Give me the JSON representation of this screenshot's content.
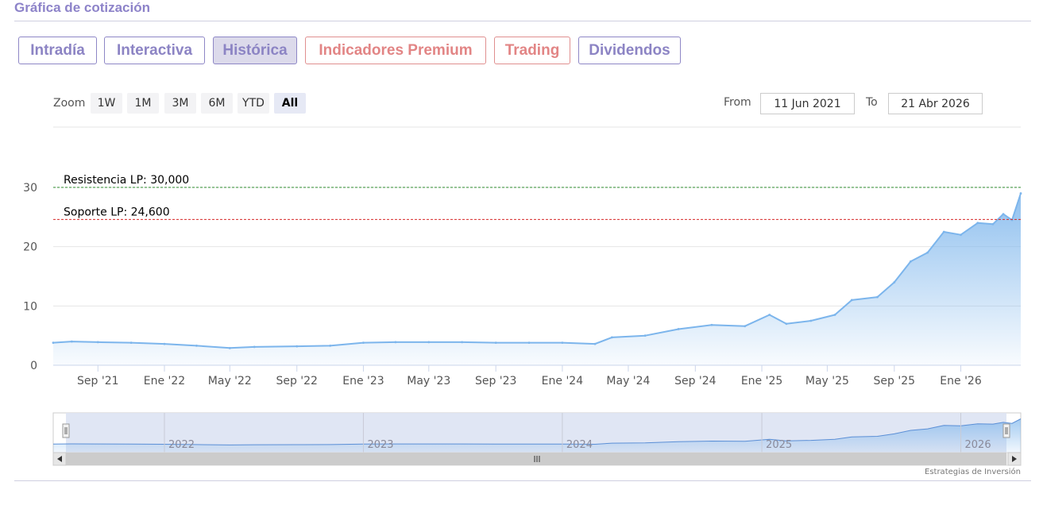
{
  "header": {
    "title": "Gráfica de cotización"
  },
  "tabs": [
    {
      "label": "Intradía",
      "active": false,
      "premium": false
    },
    {
      "label": "Interactiva",
      "active": false,
      "premium": false
    },
    {
      "label": "Histórica",
      "active": true,
      "premium": false
    },
    {
      "label": "Indicadores Premium",
      "active": false,
      "premium": true
    },
    {
      "label": "Trading",
      "active": false,
      "premium": true
    },
    {
      "label": "Dividendos",
      "active": false,
      "premium": false
    }
  ],
  "zoom": {
    "label": "Zoom",
    "buttons": [
      "1W",
      "1M",
      "3M",
      "6M",
      "YTD",
      "All"
    ],
    "selected": "All"
  },
  "range": {
    "from_label": "From",
    "from_value": "11 Jun 2021",
    "to_label": "To",
    "to_value": "21 Abr 2026"
  },
  "credits": "Estrategias de Inversión",
  "colors": {
    "accent": "#8c84c4",
    "premium": "#e28585",
    "series": "#7cb5ec",
    "resistance": "#2e8b2e",
    "support": "#d62828"
  },
  "chart_data": {
    "type": "area",
    "title": "",
    "xlabel": "",
    "ylabel": "",
    "ylim": [
      0,
      30
    ],
    "y_ticks": [
      "0",
      "10",
      "20",
      "30"
    ],
    "x_ticks": [
      "Sep '21",
      "Ene '22",
      "May '22",
      "Sep '22",
      "Ene '23",
      "May '23",
      "Sep '23",
      "Ene '24",
      "May '24",
      "Sep '24",
      "Ene '25",
      "May '25",
      "Sep '25",
      "Ene '26"
    ],
    "x_range": [
      "2021-06-11",
      "2026-04-21"
    ],
    "grid": "horizontal",
    "series": [
      {
        "points": [
          [
            "2021-06-11",
            3.8
          ],
          [
            "2021-07-15",
            4.0
          ],
          [
            "2021-09-01",
            3.9
          ],
          [
            "2021-11-01",
            3.8
          ],
          [
            "2022-01-01",
            3.6
          ],
          [
            "2022-03-01",
            3.3
          ],
          [
            "2022-05-01",
            2.9
          ],
          [
            "2022-06-15",
            3.1
          ],
          [
            "2022-09-01",
            3.2
          ],
          [
            "2022-11-01",
            3.3
          ],
          [
            "2023-01-01",
            3.8
          ],
          [
            "2023-03-01",
            3.9
          ],
          [
            "2023-05-01",
            3.9
          ],
          [
            "2023-07-01",
            3.9
          ],
          [
            "2023-09-01",
            3.8
          ],
          [
            "2023-11-01",
            3.8
          ],
          [
            "2024-01-01",
            3.8
          ],
          [
            "2024-03-01",
            3.6
          ],
          [
            "2024-04-01",
            4.7
          ],
          [
            "2024-06-01",
            5.0
          ],
          [
            "2024-08-01",
            6.1
          ],
          [
            "2024-10-01",
            6.8
          ],
          [
            "2024-12-01",
            6.6
          ],
          [
            "2025-01-15",
            8.5
          ],
          [
            "2025-02-15",
            7.0
          ],
          [
            "2025-04-01",
            7.5
          ],
          [
            "2025-05-15",
            8.5
          ],
          [
            "2025-06-15",
            11.0
          ],
          [
            "2025-08-01",
            11.5
          ],
          [
            "2025-09-01",
            14.0
          ],
          [
            "2025-10-01",
            17.5
          ],
          [
            "2025-11-01",
            19.0
          ],
          [
            "2025-12-01",
            22.5
          ],
          [
            "2026-01-01",
            22.0
          ],
          [
            "2026-02-01",
            24.0
          ],
          [
            "2026-03-01",
            23.8
          ],
          [
            "2026-03-20",
            25.5
          ],
          [
            "2026-04-05",
            24.5
          ],
          [
            "2026-04-21",
            29.0
          ]
        ]
      }
    ],
    "annotations": [
      {
        "label": "Resistencia LP: 30,000",
        "y": 30.0,
        "style": "dashed",
        "color": "#2e8b2e"
      },
      {
        "label": "Soporte LP: 24,600",
        "y": 24.6,
        "style": "dashed",
        "color": "#d62828"
      }
    ],
    "navigator": {
      "year_labels": [
        "2022",
        "2023",
        "2024",
        "2025",
        "2026"
      ]
    }
  }
}
